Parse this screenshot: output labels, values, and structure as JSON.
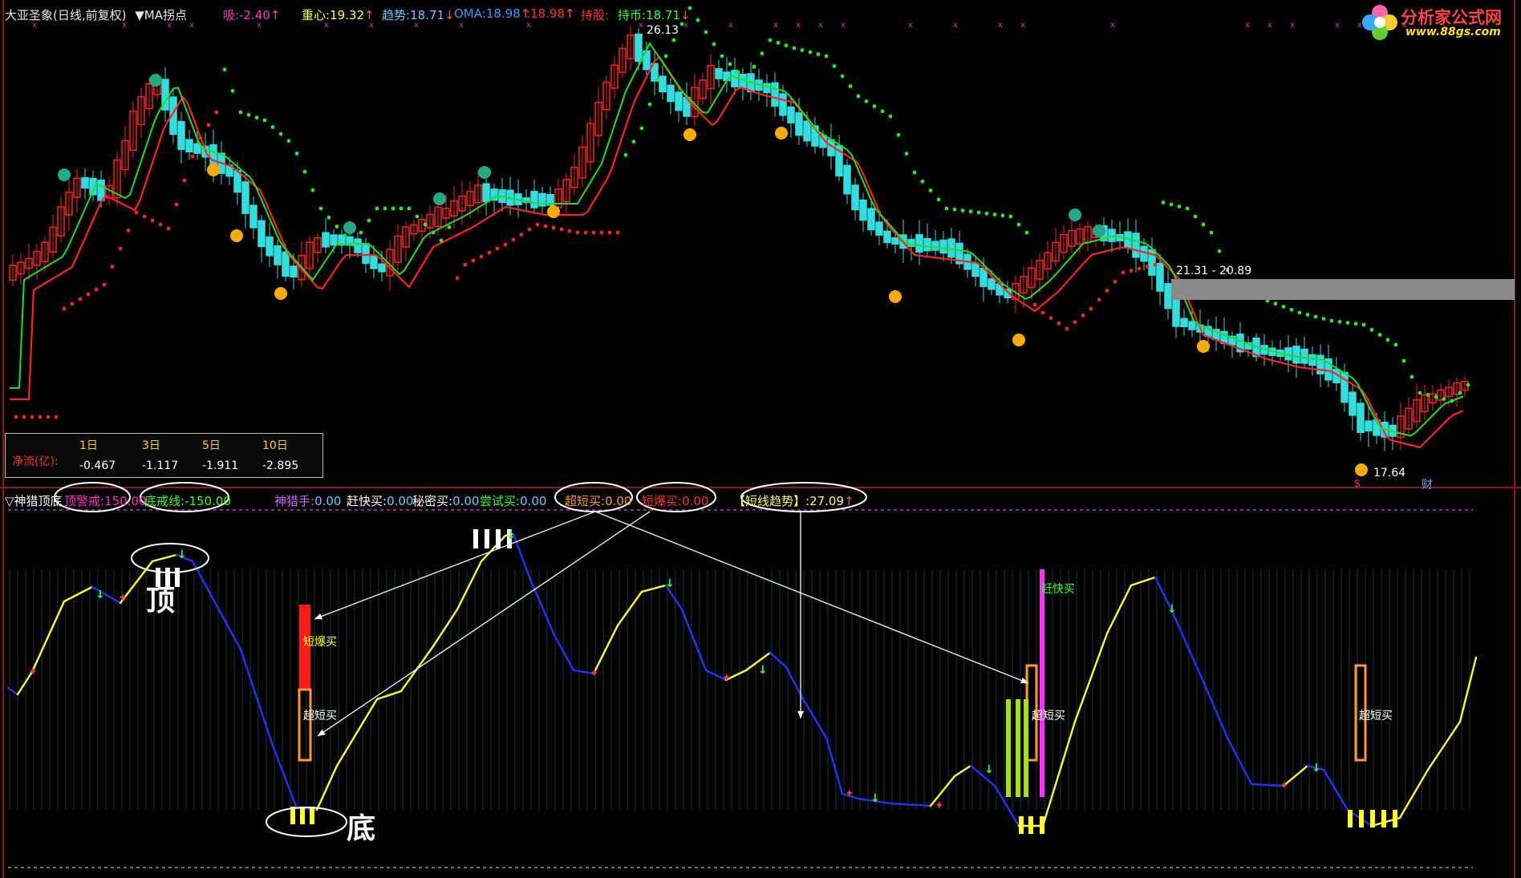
{
  "header": {
    "title": "大亚圣象(日线,前复权)",
    "ma_menu": "▼MA拐点",
    "items": [
      {
        "label": "吸:",
        "value": "-2.40",
        "arrow": "↑",
        "color": "#ff33cc"
      },
      {
        "label": "重心:",
        "value": "19.32",
        "arrow": "↑",
        "color": "#ffff33"
      },
      {
        "label": "趋势:",
        "value": "18.71",
        "arrow": "↓",
        "color": "#66ccff"
      },
      {
        "label": "OMA:",
        "value": "18.98",
        "arrow": "↑",
        "color": "#3399ff"
      },
      {
        "label": ":",
        "value": "18.98",
        "arrow": "↑",
        "color": "#ff3333"
      },
      {
        "label": "持股:",
        "value": "",
        "arrow": "",
        "color": "#ff3333"
      },
      {
        "label": "持币:",
        "value": "18.71",
        "arrow": "↓",
        "color": "#33ff33"
      }
    ]
  },
  "logo": {
    "text": "分析家公式网",
    "url_text": "www.88gs.com"
  },
  "price_labels": {
    "high": "26.13",
    "low": "17.64",
    "range": "21.31 - 20.89",
    "marker_s": "$",
    "marker_cai": "财"
  },
  "net_flow": {
    "label": "净流(亿):",
    "periods": [
      "1日",
      "3日",
      "5日",
      "10日"
    ],
    "values": [
      "-0.467",
      "-1.117",
      "-1.911",
      "-2.895"
    ]
  },
  "indicator": {
    "name": "▽神猎顶底",
    "items": [
      {
        "label": "顶警戒:",
        "value": "150.00",
        "color": "#ff33cc"
      },
      {
        "label": "底戒线:",
        "value": "-150.00",
        "color": "#33ff33"
      },
      {
        "label": "神猎手:",
        "value": "0.00",
        "color": "#cc66ff"
      },
      {
        "label": "赶快买:",
        "value": "0.00",
        "color": "#ffffff"
      },
      {
        "label": "秘密买:",
        "value": "0.00",
        "color": "#ffffff"
      },
      {
        "label": "尝试买:",
        "value": "0.00",
        "color": "#33ff33"
      },
      {
        "label": "超短买:",
        "value": "0.00",
        "color": "#ff9933"
      },
      {
        "label": "短爆买:",
        "value": "0.00",
        "color": "#ff3333"
      },
      {
        "label": "【短线趋势】:",
        "value": "27.09",
        "arrow": "↑",
        "color": "#ffff66"
      }
    ]
  },
  "annotations": {
    "top": "顶",
    "bottom": "底",
    "short_burst_buy": "短爆买",
    "ultra_short_buy": "超短买",
    "hurry_buy": "赶快买"
  },
  "colors": {
    "bull": "#ff2020",
    "bear": "#33dddd",
    "ma_green": "#22dd22",
    "ma_red": "#ff2222",
    "osc_yellow": "#ffff33",
    "osc_blue": "#2233ff"
  }
}
